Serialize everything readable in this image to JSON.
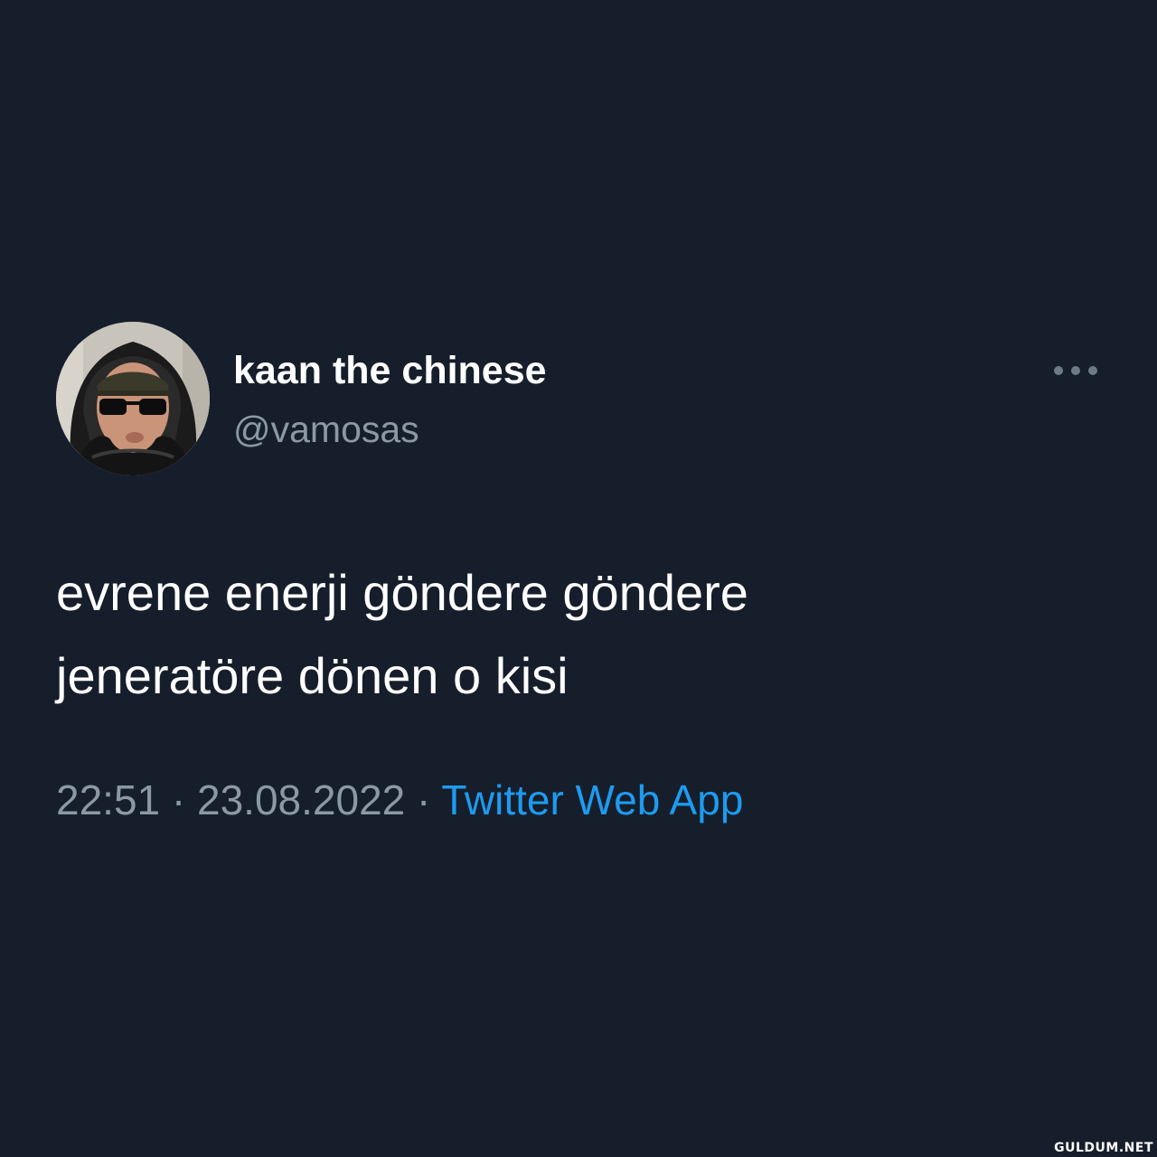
{
  "tweet": {
    "author": {
      "display_name": "kaan the chinese",
      "handle": "@vamosas",
      "avatar_icon": "profile-photo"
    },
    "more_icon": "more-horizontal-icon",
    "text_lines": [
      "evrene enerji göndere göndere",
      "jeneratöre dönen o kisi"
    ],
    "time": "22:51",
    "date": "23.08.2022",
    "separator": "·",
    "source": "Twitter Web App"
  },
  "watermark": "GULDUM.NET",
  "colors": {
    "background": "#161e2b",
    "primary_text": "#ffffff",
    "secondary_text": "#8b98a5",
    "link": "#1d9bf0"
  }
}
